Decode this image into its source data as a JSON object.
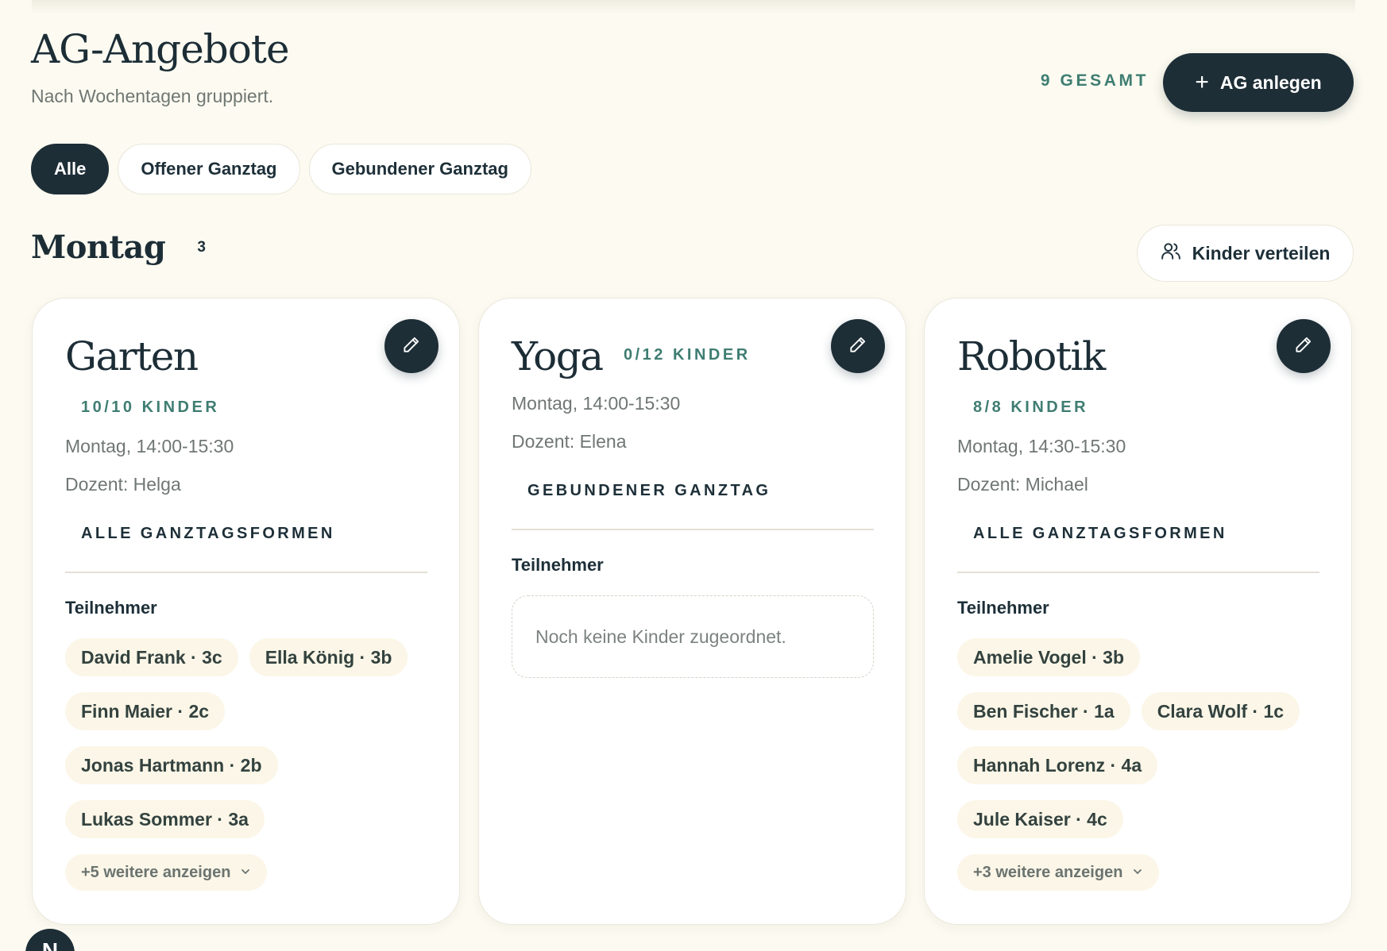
{
  "header": {
    "title": "AG-Angebote",
    "subtitle": "Nach Wochentagen gruppiert.",
    "total": "9 GESAMT",
    "add_button": "AG anlegen"
  },
  "filters": [
    {
      "label": "Alle",
      "active": true
    },
    {
      "label": "Offener Ganztag",
      "active": false
    },
    {
      "label": "Gebundener Ganztag",
      "active": false
    }
  ],
  "day": {
    "title": "Montag",
    "count": "3",
    "distribute_button": "Kinder verteilen"
  },
  "participants_label": "Teilnehmer",
  "cards": [
    {
      "name": "Garten",
      "capacity": "10/10 KINDER",
      "time": "Montag, 14:00-15:30",
      "teacher": "Dozent: Helga",
      "form": "ALLE GANZTAGSFORMEN",
      "participants": [
        "David Frank · 3c",
        "Ella König · 3b",
        "Finn Maier · 2c",
        "Jonas Hartmann · 2b",
        "Lukas Sommer · 3a"
      ],
      "more": "+5 weitere anzeigen"
    },
    {
      "name": "Yoga",
      "capacity": "0/12 KINDER",
      "time": "Montag, 14:00-15:30",
      "teacher": "Dozent: Elena",
      "form": "GEBUNDENER GANZTAG",
      "empty": "Noch keine Kinder zugeordnet."
    },
    {
      "name": "Robotik",
      "capacity": "8/8 KINDER",
      "time": "Montag, 14:30-15:30",
      "teacher": "Dozent: Michael",
      "form": "ALLE GANZTAGSFORMEN",
      "participants": [
        "Amelie Vogel · 3b",
        "Ben Fischer · 1a",
        "Clara Wolf · 1c",
        "Hannah Lorenz · 4a",
        "Jule Kaiser · 4c"
      ],
      "more": "+3 weitere anzeigen"
    }
  ],
  "avatar": {
    "initial": "N"
  },
  "colors": {
    "accent": "#3f7d72",
    "dark": "#1e2e37",
    "background": "#fdfbf1",
    "pill": "#fbf6e7"
  },
  "icons": [
    "plus-icon",
    "users-icon",
    "pencil-icon",
    "chevron-down-icon"
  ]
}
